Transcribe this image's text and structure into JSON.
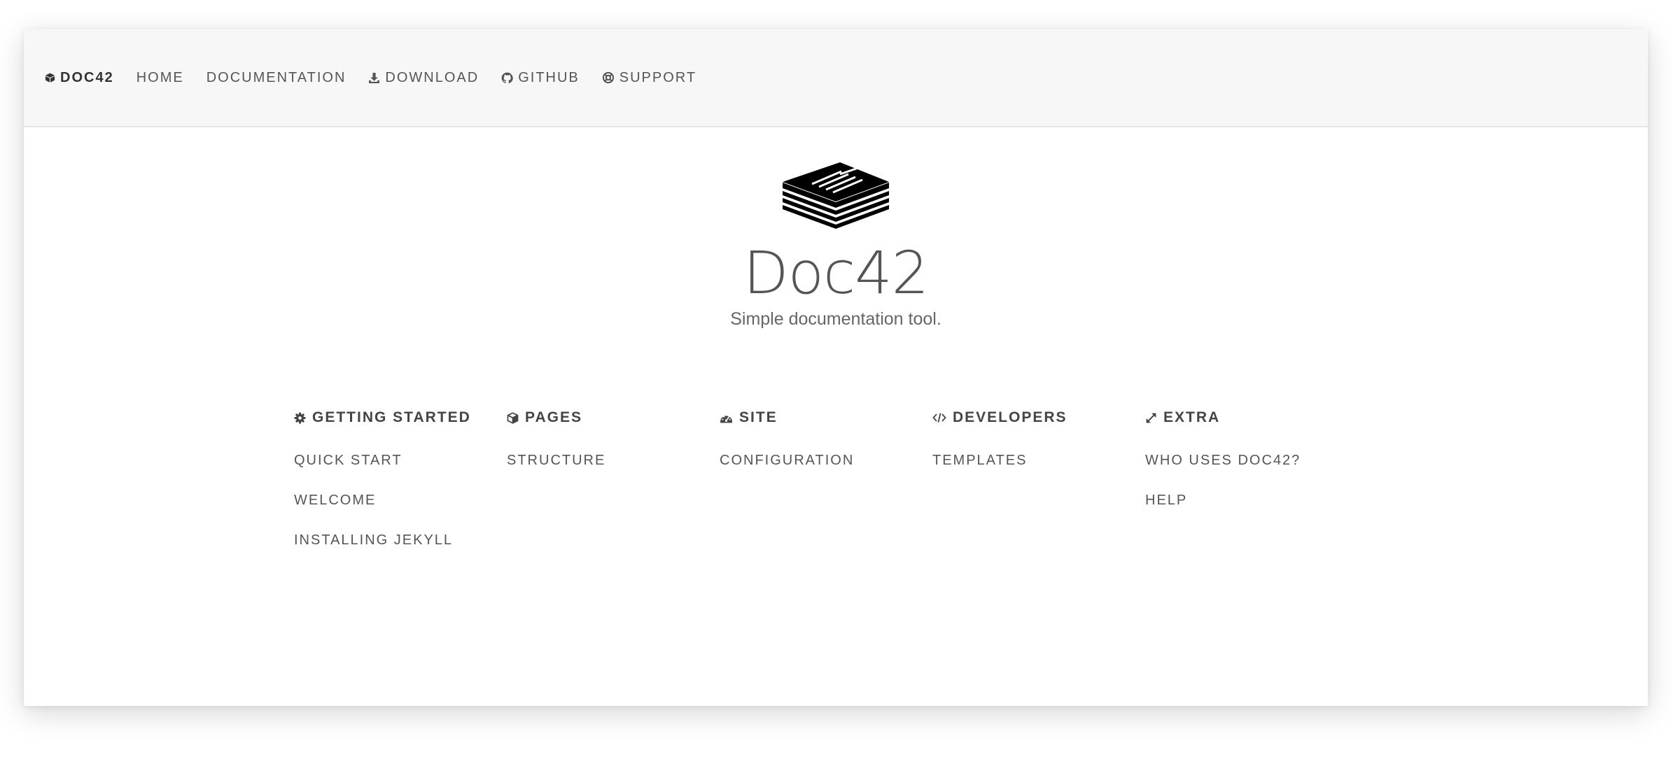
{
  "nav": {
    "brand": "DOC42",
    "items": [
      {
        "label": "HOME",
        "icon": ""
      },
      {
        "label": "DOCUMENTATION",
        "icon": ""
      },
      {
        "label": "DOWNLOAD",
        "icon": "download-icon"
      },
      {
        "label": "GITHUB",
        "icon": "github-icon"
      },
      {
        "label": "SUPPORT",
        "icon": "life-ring-icon"
      }
    ]
  },
  "hero": {
    "title": "Doc42",
    "tagline": "Simple documentation tool."
  },
  "sections": [
    {
      "title": "GETTING STARTED",
      "icon": "gear-icon",
      "links": [
        "QUICK START",
        "WELCOME",
        "INSTALLING JEKYLL"
      ]
    },
    {
      "title": "PAGES",
      "icon": "cube-icon",
      "links": [
        "STRUCTURE"
      ]
    },
    {
      "title": "SITE",
      "icon": "dashboard-icon",
      "links": [
        "CONFIGURATION"
      ]
    },
    {
      "title": "DEVELOPERS",
      "icon": "code-icon",
      "links": [
        "TEMPLATES"
      ]
    },
    {
      "title": "EXTRA",
      "icon": "expand-icon",
      "links": [
        "WHO USES DOC42?",
        "HELP"
      ]
    }
  ],
  "colors": {
    "navbar_bg": "#f7f7f7",
    "text": "#555555",
    "heading": "#444444"
  }
}
